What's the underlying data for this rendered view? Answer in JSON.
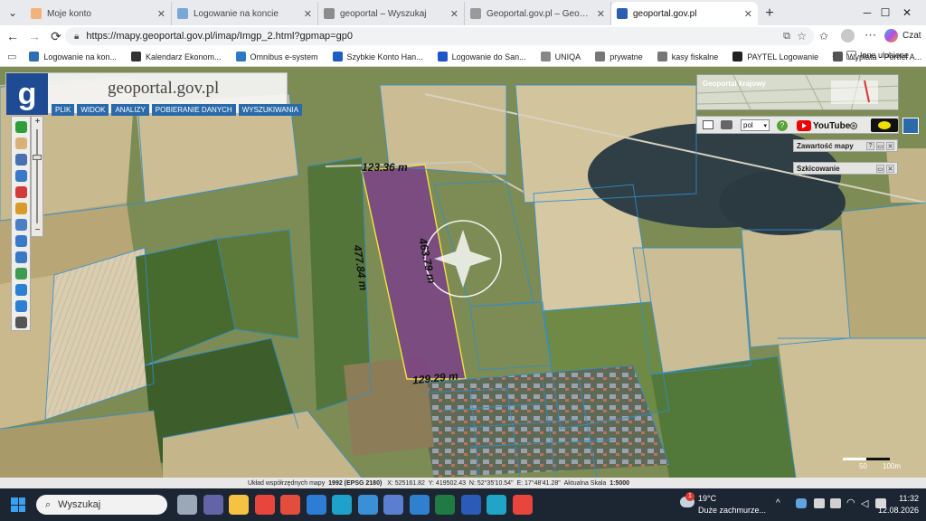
{
  "browser": {
    "tabs": [
      {
        "title": "Moje konto",
        "color": "#f2b27a",
        "active": false
      },
      {
        "title": "Logowanie na koncie",
        "color": "#7aa6d8",
        "active": false
      },
      {
        "title": "geoportal – Wyszukaj",
        "color": "#8c8c8c",
        "active": false
      },
      {
        "title": "Geoportal.gov.pl – Geoportal Infra",
        "color": "#9a9a9a",
        "active": false
      },
      {
        "title": "geoportal.gov.pl",
        "color": "#2b5fb0",
        "active": true
      }
    ],
    "new_tab": "+",
    "window_controls": {
      "minimize": "─",
      "maximize": "☐",
      "close": "✕"
    },
    "url": "https://mapy.geoportal.gov.pl/imap/Imgp_2.html?gpmap=gp0",
    "copilot_label": "Czat",
    "favorites": [
      {
        "label": "Logowanie na kon...",
        "color": "#2f6db5"
      },
      {
        "label": "Kalendarz Ekonom...",
        "color": "#333333"
      },
      {
        "label": "Omnibus e-system",
        "color": "#2b79c6"
      },
      {
        "label": "Szybkie Konto Han...",
        "color": "#1c5fbf"
      },
      {
        "label": "Logowanie do San...",
        "color": "#1d55c9"
      },
      {
        "label": "UNIQA",
        "color": "#888888"
      },
      {
        "label": "prywatne",
        "color": "#777777"
      },
      {
        "label": "kasy fiskalne",
        "color": "#777777"
      },
      {
        "label": "PAYTEL Logowanie",
        "color": "#222222"
      },
      {
        "label": "Wypłata - Portfel A...",
        "color": "#555555"
      }
    ],
    "favorites_more": "Inne ulubione"
  },
  "geoportal": {
    "logo_letter": "g",
    "site_name": "geoportal.gov.pl",
    "menu": [
      "PLIK",
      "WIDOK",
      "ANALIZY",
      "POBIERANIE DANYCH",
      "WYSZUKIWANIA"
    ],
    "overview_label": "Geoportal krajowy",
    "language": "pol",
    "youtube_label": "YouTube",
    "panels": [
      {
        "title": "Zawartość mapy"
      },
      {
        "title": "Szkicowanie"
      }
    ],
    "tools": [
      {
        "icon": "info-icon",
        "color": "#2e9e3c"
      },
      {
        "icon": "hand-icon",
        "color": "#d8b07a"
      },
      {
        "icon": "document-icon",
        "color": "#4a6fb3"
      },
      {
        "icon": "select-area-icon",
        "color": "#3a78c8"
      },
      {
        "icon": "erase-selection-icon",
        "color": "#d23b3b"
      },
      {
        "icon": "pencil-icon",
        "color": "#d89a2a"
      },
      {
        "icon": "measure-icon",
        "color": "#4a7fc4"
      },
      {
        "icon": "zoom-in-icon",
        "color": "#3a78c8"
      },
      {
        "icon": "zoom-out-icon",
        "color": "#3a78c8"
      },
      {
        "icon": "globe-icon",
        "color": "#3f9a52"
      },
      {
        "icon": "back-arrow-icon",
        "color": "#2d7fd2"
      },
      {
        "icon": "forward-arrow-icon",
        "color": "#2d7fd2"
      },
      {
        "icon": "full-extent-icon",
        "color": "#555555"
      }
    ],
    "zoom_plus": "+",
    "zoom_minus": "−",
    "parcel_dimensions": {
      "top": "123.36 m",
      "left": "477.84 m",
      "right": "463.79 m",
      "bottom": "129.29 m"
    },
    "scale_labels": [
      "50",
      "100m"
    ],
    "status": {
      "crs_label": "Układ współrzędnych mapy",
      "crs": "1992 (EPSG 2180)",
      "x": "X: 525161.82",
      "y": "Y: 419502.43",
      "n": "N: 52°35'10.54\"",
      "e": "E: 17°48'41.28\"",
      "scale_label": "Aktualna Skala",
      "scale": "1:5000"
    }
  },
  "taskbar": {
    "search_placeholder": "Wyszukaj",
    "weather_temp": "19°C",
    "weather_desc": "Duże zachmurze...",
    "weather_badge": "1",
    "time": "11:32",
    "date": "12.08.2026",
    "apps": [
      {
        "icon": "task-view-icon",
        "color": "#9aa8b8"
      },
      {
        "icon": "teams-icon",
        "color": "#6264a7"
      },
      {
        "icon": "file-explorer-icon",
        "color": "#f5c242"
      },
      {
        "icon": "chrome-icon",
        "color": "#e8453c"
      },
      {
        "icon": "store-icon",
        "color": "#e24d3c"
      },
      {
        "icon": "photos-icon",
        "color": "#2d7cd6"
      },
      {
        "icon": "edge-icon",
        "color": "#1ea2c9"
      },
      {
        "icon": "browser-icon",
        "color": "#3b8fd8"
      },
      {
        "icon": "app-icon",
        "color": "#5a7fd1"
      },
      {
        "icon": "onedrive-icon",
        "color": "#2f81cf"
      },
      {
        "icon": "excel-icon",
        "color": "#1f7a43"
      },
      {
        "icon": "word-icon",
        "color": "#2b5ab8"
      },
      {
        "icon": "edge-active-icon",
        "color": "#22a3c8"
      },
      {
        "icon": "chrome-profile-icon",
        "color": "#e8453c"
      }
    ]
  }
}
